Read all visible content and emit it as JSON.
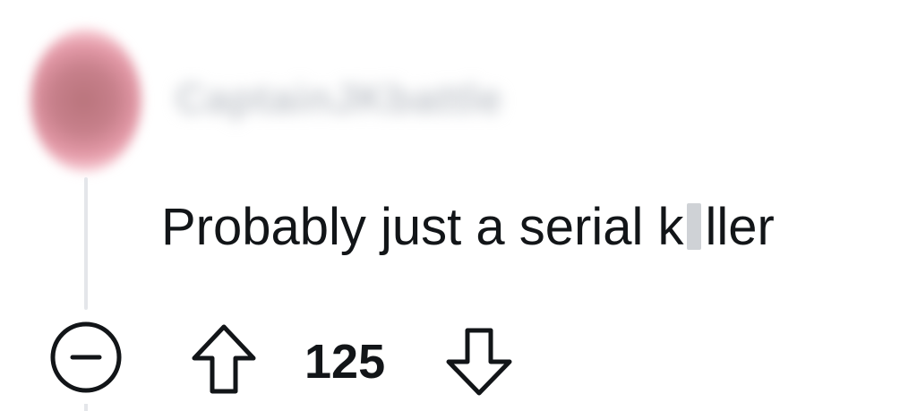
{
  "comment": {
    "username": "CaptainJKbattle",
    "text_before": "Probably just a serial k",
    "text_after": "ller",
    "score": "125"
  },
  "icons": {
    "collapse": "minus-circle-icon",
    "upvote": "arrow-up-icon",
    "downvote": "arrow-down-icon"
  },
  "colors": {
    "text": "#121518",
    "thread_line": "#e4e6ea",
    "avatar": "#c7808b"
  }
}
